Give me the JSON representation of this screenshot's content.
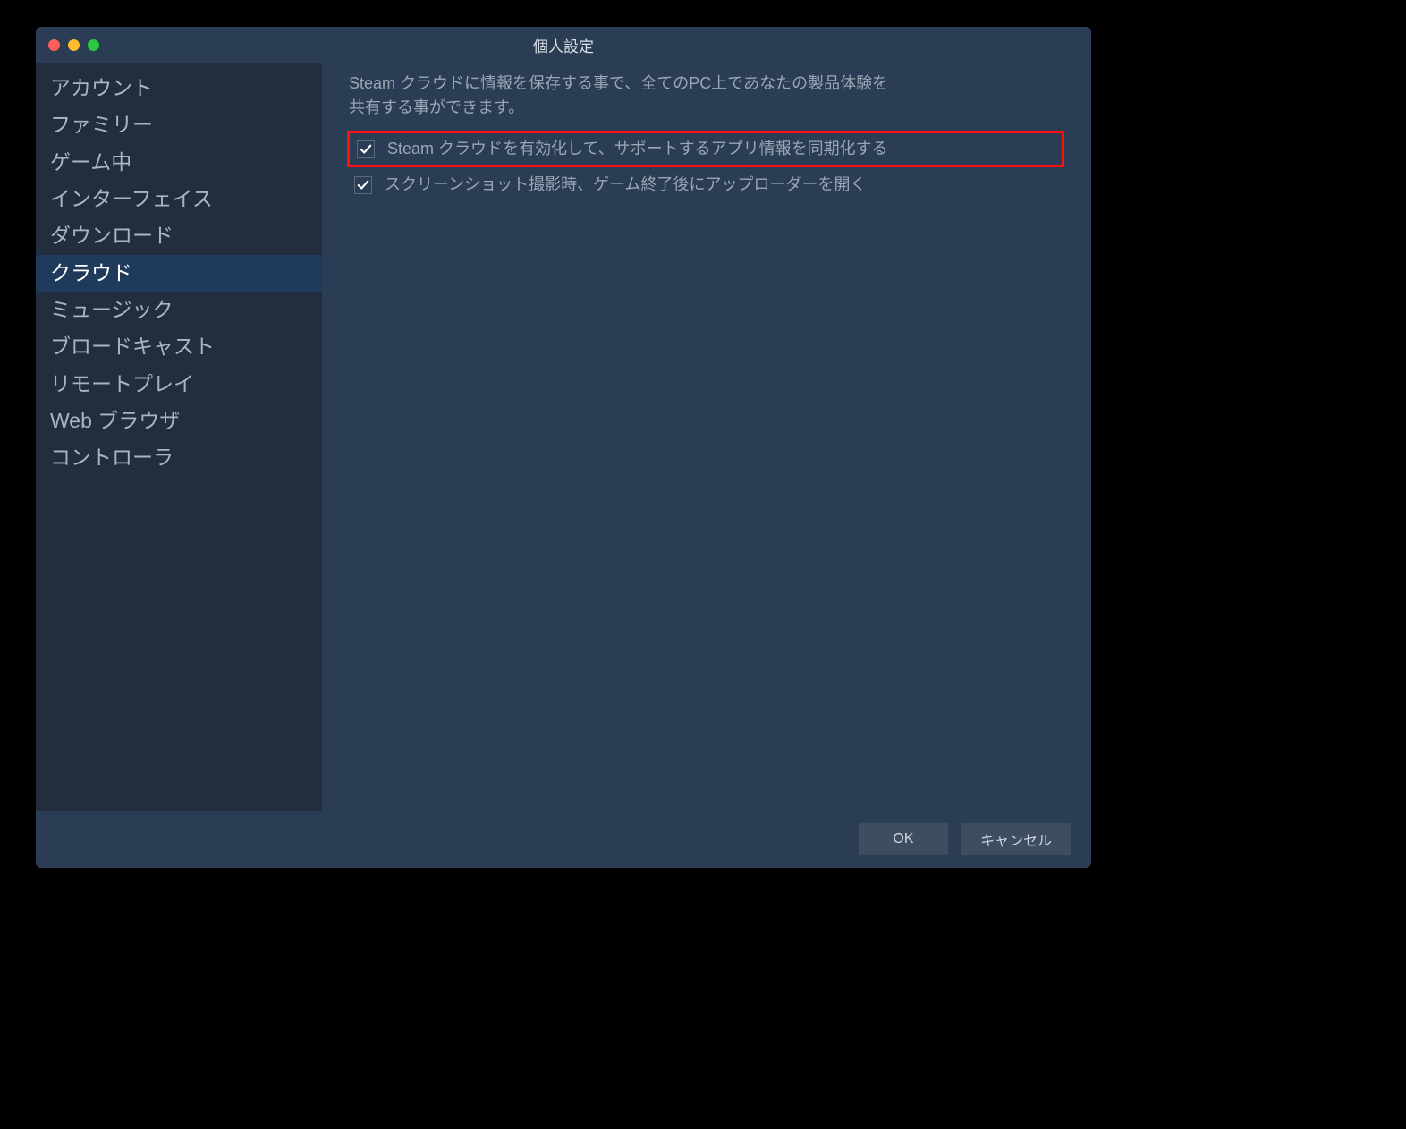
{
  "window": {
    "title": "個人設定"
  },
  "sidebar": {
    "items": [
      {
        "label": "アカウント"
      },
      {
        "label": "ファミリー"
      },
      {
        "label": "ゲーム中"
      },
      {
        "label": "インターフェイス"
      },
      {
        "label": "ダウンロード"
      },
      {
        "label": "クラウド"
      },
      {
        "label": "ミュージック"
      },
      {
        "label": "ブロードキャスト"
      },
      {
        "label": "リモートプレイ"
      },
      {
        "label": "Web ブラウザ"
      },
      {
        "label": "コントローラ"
      }
    ],
    "selected_index": 5
  },
  "content": {
    "description": "Steam クラウドに情報を保存する事で、全てのPC上であなたの製品体験を共有する事ができます。",
    "options": [
      {
        "label": "Steam クラウドを有効化して、サポートするアプリ情報を同期化する",
        "checked": true,
        "highlighted": true
      },
      {
        "label": "スクリーンショット撮影時、ゲーム終了後にアップローダーを開く",
        "checked": true,
        "highlighted": false
      }
    ]
  },
  "footer": {
    "ok_label": "OK",
    "cancel_label": "キャンセル"
  }
}
